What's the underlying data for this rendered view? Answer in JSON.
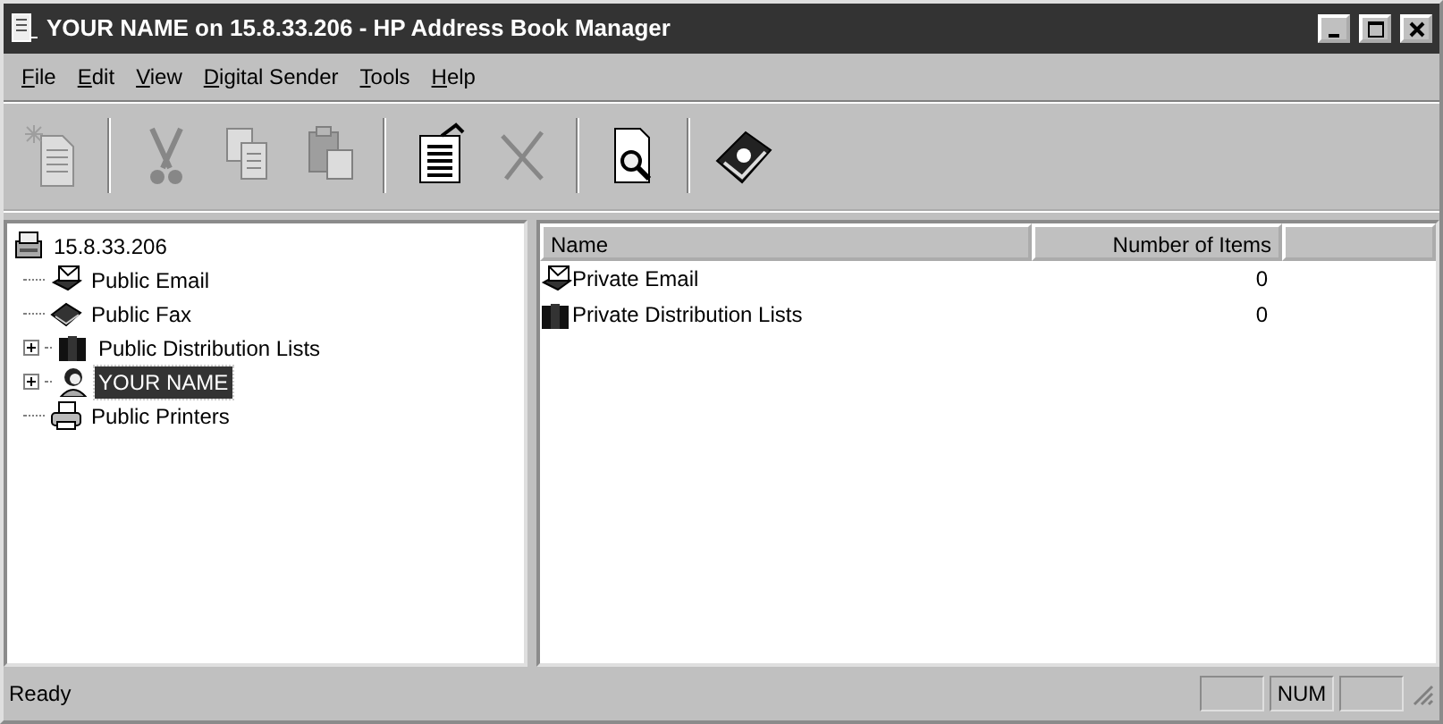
{
  "window": {
    "title": "YOUR NAME on 15.8.33.206 - HP Address Book Manager"
  },
  "menu": [
    {
      "access_key": "F",
      "rest": "ile"
    },
    {
      "access_key": "E",
      "rest": "dit"
    },
    {
      "access_key": "V",
      "rest": "iew"
    },
    {
      "access_key": "D",
      "rest": "igital Sender"
    },
    {
      "access_key": "T",
      "rest": "ools"
    },
    {
      "access_key": "H",
      "rest": "elp"
    }
  ],
  "toolbar": [
    {
      "kind": "new",
      "disabled": true
    },
    {
      "kind": "separator"
    },
    {
      "kind": "cut",
      "disabled": true
    },
    {
      "kind": "copy",
      "disabled": true
    },
    {
      "kind": "paste",
      "disabled": true
    },
    {
      "kind": "separator"
    },
    {
      "kind": "properties",
      "disabled": false
    },
    {
      "kind": "delete",
      "disabled": true
    },
    {
      "kind": "separator"
    },
    {
      "kind": "preview",
      "disabled": false
    },
    {
      "kind": "separator"
    },
    {
      "kind": "help",
      "disabled": false
    }
  ],
  "tree": {
    "label": "15.8.33.206",
    "kind": "server",
    "selected": false,
    "children": [
      {
        "label": "Public Email",
        "kind": "email",
        "selected": false
      },
      {
        "label": "Public Fax",
        "kind": "fax",
        "selected": false
      },
      {
        "label": "Public Distribution Lists",
        "kind": "lists",
        "selected": false,
        "expanded": false
      },
      {
        "label": "YOUR NAME",
        "kind": "person",
        "selected": true,
        "expanded": false
      },
      {
        "label": "Public Printers",
        "kind": "printer",
        "selected": false
      }
    ]
  },
  "table": {
    "columns": [
      "Name",
      "Number of Items"
    ],
    "rows": [
      {
        "name": "Private Email",
        "kind": "email",
        "count": "0"
      },
      {
        "name": "Private Distribution Lists",
        "kind": "lists",
        "count": "0"
      }
    ]
  },
  "status_bar": {
    "text": "Ready",
    "panels": [
      {
        "kind": "blank"
      },
      {
        "kind": "text",
        "text": "NUM"
      },
      {
        "kind": "blank"
      }
    ]
  }
}
